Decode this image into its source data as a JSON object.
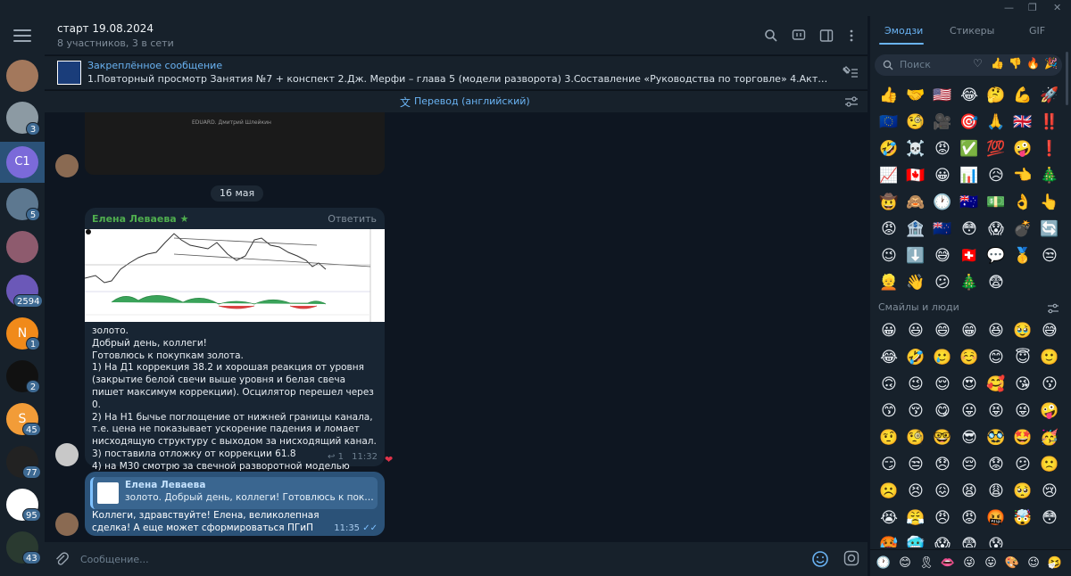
{
  "window": {
    "min": "—",
    "max": "❐",
    "close": "✕"
  },
  "header": {
    "title": "старт 19.08.2024",
    "subtitle": "8 участников, 3 в сети"
  },
  "rail": {
    "badges": [
      "3",
      "5",
      "2594",
      "1",
      "2",
      "45",
      "77",
      "95",
      "43"
    ],
    "selected_label": "С1",
    "n_label": "N",
    "s_label": "S"
  },
  "pinned": {
    "title": "Закреплённое сообщение",
    "text": "1.Повторный просмотр Занятия №7 + конспект 2.Дж. Мерфи – глава 5 (модели разворота) 3.Составление «Руководства по торговле» 4.Активно торговать на демо-счете..."
  },
  "translate": {
    "label": "Перевод (английский)"
  },
  "chat": {
    "date_pill": "16 мая",
    "msg1": {
      "author": "Елена Леваева",
      "reply": "Ответить",
      "text": "золото.\nДобрый день, коллеги!\nГотовлюсь к покупкам золота.\n1) На Д1 коррекция 38.2 и хорошая реакция от уровня (закрытие белой свечи выше уровня и белая свеча пишет максимум коррекции). Осцилятор перешел через 0.\n2) На Н1 бычье поглощение от нижней границы канала, т.е. цена не показывает ускорение падения и ломает нисходящую структуру с выходом за нисходящий канал.\n3) поставила отложку от коррекции 61.8\n4) на М30 смотрю за свечной разворотной моделью",
      "replies": "1",
      "time": "11:32",
      "reaction": "❤"
    },
    "msg2": {
      "quote_author": "Елена Леваева",
      "quote_text": "золото. Добрый день, коллеги! Готовлюсь к покупкам з...",
      "text": "Коллеги, здравствуйте! Елена, великолепная сделка! А еще может сформироваться ПГиП",
      "time": "11:35"
    },
    "image_caption": "EDUARD. Дмитрий Шлейкин"
  },
  "composer": {
    "placeholder": "Сообщение..."
  },
  "panel": {
    "tabs": [
      "Эмодзи",
      "Стикеры",
      "GIF"
    ],
    "search_placeholder": "Поиск",
    "section_title": "Смайлы и люди",
    "recent": [
      "👍",
      "🤝",
      "🇺🇸",
      "😂",
      "🤔",
      "💪",
      "🚀",
      "🇪🇺",
      "🧐",
      "🎥",
      "🎯",
      "🙏",
      "🇬🇧",
      "‼️",
      "🤣",
      "☠️",
      "😡",
      "✅",
      "💯",
      "🤪",
      "❗",
      "📈",
      "🇨🇦",
      "😀",
      "📊",
      "😥",
      "👈",
      "🎄",
      "🤠",
      "🙈",
      "🕐",
      "🇦🇺",
      "💵",
      "👌",
      "👆",
      "😡",
      "🏦",
      "🇳🇿",
      "😳",
      "😱",
      "💣",
      "🔄",
      "😉",
      "⬇️",
      "😅",
      "🇨🇭",
      "💬",
      "🥇",
      "😒",
      "👱",
      "👋",
      "😕",
      "🎄",
      "😨"
    ],
    "smileys": [
      "😀",
      "😃",
      "😄",
      "😁",
      "😆",
      "🥹",
      "😅",
      "😂",
      "🤣",
      "🥲",
      "☺️",
      "😊",
      "😇",
      "🙂",
      "🙃",
      "😉",
      "😌",
      "😍",
      "🥰",
      "😘",
      "😗",
      "😙",
      "😚",
      "😋",
      "😛",
      "😝",
      "😜",
      "🤪",
      "🤨",
      "🧐",
      "🤓",
      "😎",
      "🥸",
      "🤩",
      "🥳",
      "😏",
      "😒",
      "😞",
      "😔",
      "😟",
      "😕",
      "🙁",
      "☹️",
      "😣",
      "😖",
      "😫",
      "😩",
      "🥺",
      "😢",
      "😭",
      "😤",
      "😠",
      "😡",
      "🤬",
      "🤯",
      "😳",
      "🥵",
      "🥶",
      "😱",
      "😨",
      "😰"
    ],
    "bottom_icons": [
      "🕐",
      "😊",
      "🎗",
      "👄",
      "😜",
      "😛",
      "🎨",
      "😉",
      "🤧"
    ]
  }
}
